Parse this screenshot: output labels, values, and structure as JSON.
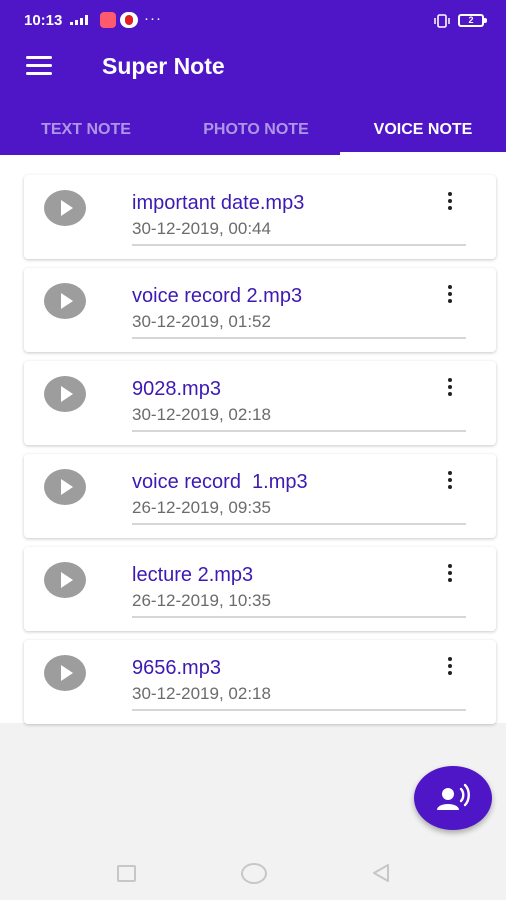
{
  "status_bar": {
    "time": "10:13",
    "battery": "2",
    "more": "···"
  },
  "app_bar": {
    "title": "Super Note",
    "color": "#4f16c7"
  },
  "tabs": [
    {
      "label": "TEXT NOTE",
      "selected": false
    },
    {
      "label": "PHOTO NOTE",
      "selected": false
    },
    {
      "label": "VOICE NOTE",
      "selected": true
    }
  ],
  "recordings": [
    {
      "name": "important date.mp3",
      "date": "30-12-2019, 00:44"
    },
    {
      "name": "voice record 2.mp3",
      "date": "30-12-2019, 01:52"
    },
    {
      "name": "9028.mp3",
      "date": "30-12-2019, 02:18"
    },
    {
      "name": "voice record  1.mp3",
      "date": "26-12-2019, 09:35"
    },
    {
      "name": "lecture 2.mp3",
      "date": "26-12-2019, 10:35"
    },
    {
      "name": "9656.mp3",
      "date": "30-12-2019, 02:18"
    }
  ],
  "icons": {
    "menu": "hamburger-icon",
    "play": "play-icon",
    "more": "more-vertical-icon",
    "fab": "voice-record-icon"
  }
}
